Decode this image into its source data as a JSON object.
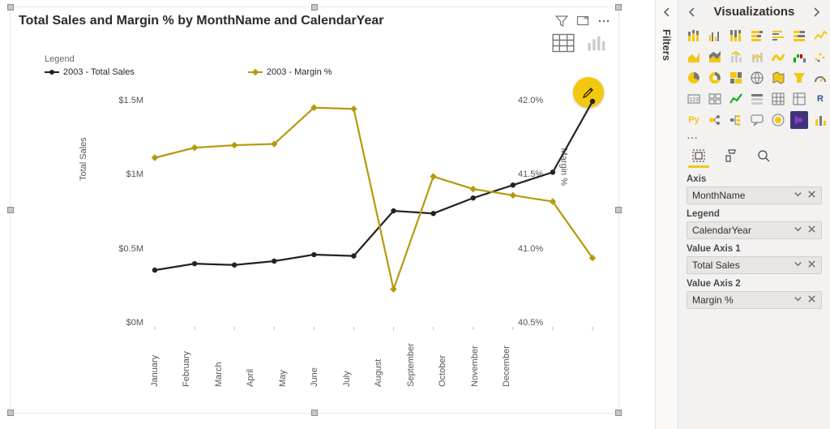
{
  "visual": {
    "title": "Total Sales and Margin % by MonthName and CalendarYear",
    "legend_heading": "Legend",
    "legend_series1": "2003 - Total Sales",
    "legend_series2": "2003 - Margin %",
    "axis_left_title": "Total Sales",
    "axis_right_title": "Margin %"
  },
  "y_left_ticks": [
    "$1.5M",
    "$1M",
    "$0.5M",
    "$0M"
  ],
  "y_right_ticks": [
    "42.0%",
    "41.5%",
    "41.0%",
    "40.5%"
  ],
  "x_categories": [
    "January",
    "February",
    "March",
    "April",
    "May",
    "June",
    "July",
    "August",
    "September",
    "October",
    "November",
    "December"
  ],
  "chart_data": {
    "type": "line",
    "title": "Total Sales and Margin % by MonthName and CalendarYear",
    "categories": [
      "January",
      "February",
      "March",
      "April",
      "May",
      "June",
      "July",
      "August",
      "September",
      "October",
      "November",
      "December"
    ],
    "series": [
      {
        "name": "2003 - Total Sales",
        "axis": "left",
        "color": "#222222",
        "values": [
          0.44,
          0.49,
          0.48,
          0.51,
          0.56,
          0.55,
          0.9,
          0.88,
          1.0,
          1.1,
          1.2,
          1.75
        ]
      },
      {
        "name": "2003 - Margin %",
        "axis": "right",
        "color": "#b59a0d",
        "values": [
          41.85,
          41.93,
          41.95,
          41.96,
          42.25,
          42.24,
          40.8,
          41.7,
          41.6,
          41.55,
          41.5,
          41.05
        ]
      }
    ],
    "xlabel": "MonthName",
    "ylabel_left": "Total Sales",
    "ylabel_right": "Margin %",
    "ylim_left": [
      0,
      1.75
    ],
    "ylim_right": [
      40.5,
      42.3
    ],
    "y_left_unit": "$M",
    "y_right_unit": "%"
  },
  "filters_label": "Filters",
  "viz_pane": {
    "title": "Visualizations",
    "ellipsis": "···",
    "wells": {
      "axis_label": "Axis",
      "axis_value": "MonthName",
      "legend_label": "Legend",
      "legend_value": "CalendarYear",
      "value1_label": "Value Axis 1",
      "value1_value": "Total Sales",
      "value2_label": "Value Axis 2",
      "value2_value": "Margin %"
    }
  }
}
